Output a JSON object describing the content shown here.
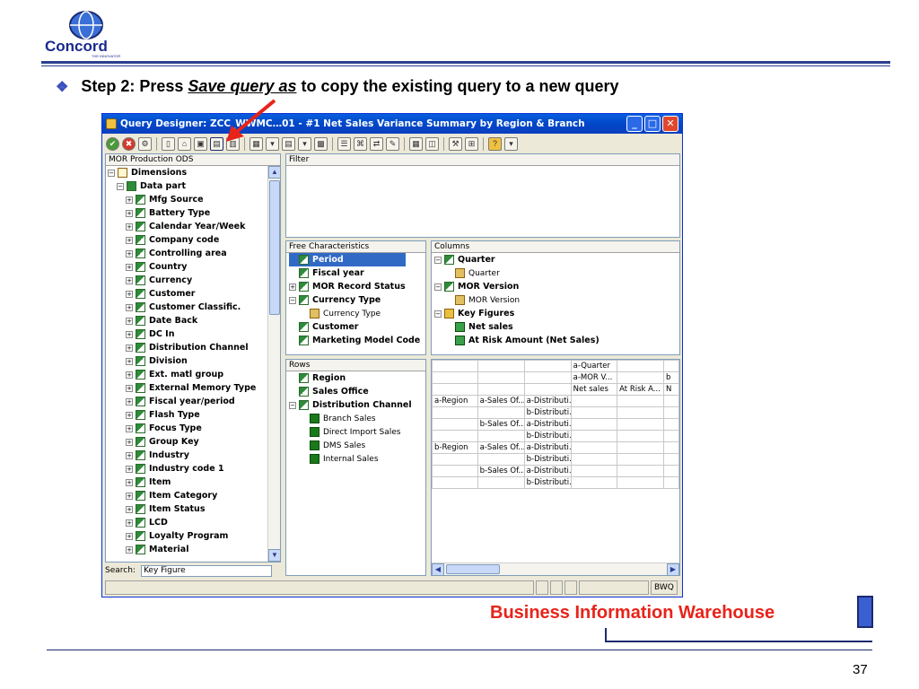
{
  "logo": {
    "text": "Concord",
    "tagline": "THE INNOVATOR"
  },
  "step": {
    "prefix": "Step 2: Press ",
    "emph": "Save query as",
    "suffix": " to copy the existing query to a new query"
  },
  "window": {
    "title": "Query Designer: ZCC_WWMC…01 - #1 Net Sales Variance Summary by Region & Branch",
    "buttons": {
      "min": "_",
      "max": "□",
      "close": "✕"
    },
    "left_header": "MOR Production ODS",
    "tree": [
      {
        "label": "Dimensions",
        "level": 0,
        "icon": "folder-icon",
        "pm": "−"
      },
      {
        "label": "Data part",
        "level": 1,
        "icon": "data-part-icon",
        "pm": "−"
      },
      {
        "label": "Mfg Source",
        "level": 2,
        "icon": "char-icon",
        "pm": "+"
      },
      {
        "label": "Battery Type",
        "level": 2,
        "icon": "char-icon",
        "pm": "+"
      },
      {
        "label": "Calendar Year/Week",
        "level": 2,
        "icon": "char-icon",
        "pm": "+"
      },
      {
        "label": "Company code",
        "level": 2,
        "icon": "char-icon",
        "pm": "+"
      },
      {
        "label": "Controlling area",
        "level": 2,
        "icon": "char-icon",
        "pm": "+"
      },
      {
        "label": "Country",
        "level": 2,
        "icon": "char-icon",
        "pm": "+"
      },
      {
        "label": "Currency",
        "level": 2,
        "icon": "char-icon",
        "pm": "+"
      },
      {
        "label": "Customer",
        "level": 2,
        "icon": "char-icon",
        "pm": "+"
      },
      {
        "label": "Customer Classific.",
        "level": 2,
        "icon": "char-icon",
        "pm": "+"
      },
      {
        "label": "Date Back",
        "level": 2,
        "icon": "char-icon",
        "pm": "+"
      },
      {
        "label": "DC In",
        "level": 2,
        "icon": "char-icon",
        "pm": "+"
      },
      {
        "label": "Distribution Channel",
        "level": 2,
        "icon": "char-icon",
        "pm": "+"
      },
      {
        "label": "Division",
        "level": 2,
        "icon": "char-icon",
        "pm": "+"
      },
      {
        "label": "Ext. matl group",
        "level": 2,
        "icon": "char-icon",
        "pm": "+"
      },
      {
        "label": "External Memory Type",
        "level": 2,
        "icon": "char-icon",
        "pm": "+"
      },
      {
        "label": "Fiscal year/period",
        "level": 2,
        "icon": "char-icon",
        "pm": "+"
      },
      {
        "label": "Flash Type",
        "level": 2,
        "icon": "char-icon",
        "pm": "+"
      },
      {
        "label": "Focus Type",
        "level": 2,
        "icon": "char-icon",
        "pm": "+"
      },
      {
        "label": "Group Key",
        "level": 2,
        "icon": "char-icon",
        "pm": "+"
      },
      {
        "label": "Industry",
        "level": 2,
        "icon": "char-icon",
        "pm": "+"
      },
      {
        "label": "Industry code 1",
        "level": 2,
        "icon": "char-icon",
        "pm": "+"
      },
      {
        "label": "Item",
        "level": 2,
        "icon": "char-icon",
        "pm": "+"
      },
      {
        "label": "Item Category",
        "level": 2,
        "icon": "char-icon",
        "pm": "+"
      },
      {
        "label": "Item Status",
        "level": 2,
        "icon": "char-icon",
        "pm": "+"
      },
      {
        "label": "LCD",
        "level": 2,
        "icon": "char-icon",
        "pm": "+"
      },
      {
        "label": "Loyalty Program",
        "level": 2,
        "icon": "char-icon",
        "pm": "+"
      },
      {
        "label": "Material",
        "level": 2,
        "icon": "char-icon",
        "pm": "+"
      }
    ],
    "search": {
      "label": "Search:",
      "value": "Key Figure"
    },
    "filter_header": "Filter",
    "free_header": "Free Characteristics",
    "free": [
      {
        "label": "Period",
        "icon": "char-icon",
        "pm": "",
        "selected": true,
        "bold": true
      },
      {
        "label": "Fiscal year",
        "icon": "char-icon",
        "pm": "",
        "bold": true
      },
      {
        "label": "MOR Record Status",
        "icon": "char-icon",
        "pm": "+",
        "bold": true
      },
      {
        "label": "Currency Type",
        "icon": "char-icon",
        "pm": "−",
        "bold": true
      },
      {
        "label": "Currency Type",
        "icon": "unit-icon",
        "pm": "",
        "bold": false,
        "indent": true
      },
      {
        "label": "Customer",
        "icon": "char-icon",
        "pm": "",
        "bold": true
      },
      {
        "label": "Marketing Model Code",
        "icon": "char-icon",
        "pm": "",
        "bold": true
      }
    ],
    "columns_header": "Columns",
    "columns": [
      {
        "label": "Quarter",
        "icon": "char-icon",
        "pm": "−",
        "bold": true
      },
      {
        "label": "Quarter",
        "icon": "unit-icon",
        "pm": "",
        "bold": false,
        "indent": true
      },
      {
        "label": "MOR Version",
        "icon": "char-icon",
        "pm": "−",
        "bold": true
      },
      {
        "label": "MOR Version",
        "icon": "unit-icon",
        "pm": "",
        "bold": false,
        "indent": true
      },
      {
        "label": "Key Figures",
        "icon": "kf-folder-icon",
        "pm": "−",
        "bold": true
      },
      {
        "label": "Net sales",
        "icon": "kf-icon",
        "pm": "",
        "bold": true,
        "indent": true
      },
      {
        "label": "At Risk Amount (Net Sales)",
        "icon": "kf-icon",
        "pm": "",
        "bold": true,
        "indent": true
      }
    ],
    "rows_header": "Rows",
    "rows": [
      {
        "label": "Region",
        "icon": "char-icon",
        "pm": "",
        "bold": true
      },
      {
        "label": "Sales Office",
        "icon": "char-icon",
        "pm": "",
        "bold": true
      },
      {
        "label": "Distribution Channel",
        "icon": "char-icon",
        "pm": "−",
        "bold": true
      },
      {
        "label": "Branch Sales",
        "icon": "value-icon",
        "pm": "",
        "bold": false,
        "indent": true
      },
      {
        "label": "Direct Import Sales",
        "icon": "value-icon",
        "pm": "",
        "bold": false,
        "indent": true
      },
      {
        "label": "DMS Sales",
        "icon": "value-icon",
        "pm": "",
        "bold": false,
        "indent": true
      },
      {
        "label": "Internal Sales",
        "icon": "value-icon",
        "pm": "",
        "bold": false,
        "indent": true
      }
    ],
    "preview": [
      [
        "",
        "",
        "",
        "a-Quarter",
        "",
        ""
      ],
      [
        "",
        "",
        "",
        "a-MOR V...",
        "",
        "b"
      ],
      [
        "",
        "",
        "",
        "Net sales",
        "At Risk A...",
        "N"
      ],
      [
        "a-Region",
        "a-Sales Of...",
        "a-Distributi...",
        "",
        "",
        ""
      ],
      [
        "",
        "",
        "b-Distributi...",
        "",
        "",
        ""
      ],
      [
        "",
        "b-Sales Of...",
        "a-Distributi...",
        "",
        "",
        ""
      ],
      [
        "",
        "",
        "b-Distributi...",
        "",
        "",
        ""
      ],
      [
        "b-Region",
        "a-Sales Of...",
        "a-Distributi...",
        "",
        "",
        ""
      ],
      [
        "",
        "",
        "b-Distributi...",
        "",
        "",
        ""
      ],
      [
        "",
        "b-Sales Of...",
        "a-Distributi...",
        "",
        "",
        ""
      ],
      [
        "",
        "",
        "b-Distributi...",
        "",
        "",
        ""
      ]
    ],
    "status_right": "BWQ"
  },
  "footer": {
    "brand": "Business Information Warehouse",
    "page": "37"
  },
  "colors": {
    "accent": "#0831d9",
    "brand_red": "#e8231a",
    "navy": "#1a2a70"
  }
}
